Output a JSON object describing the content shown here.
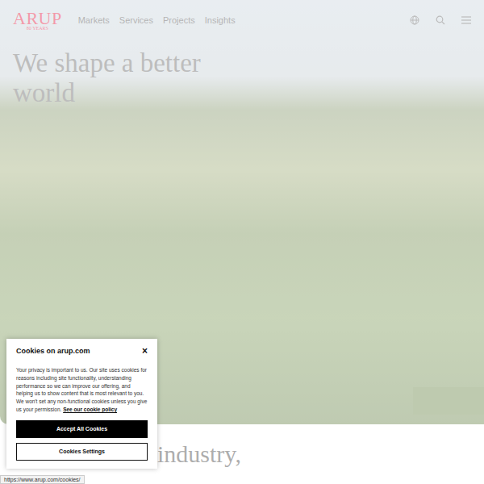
{
  "header": {
    "logo": "ARUP",
    "logo_sub": "80 YEARS",
    "nav": [
      "Markets",
      "Services",
      "Projects",
      "Insights"
    ]
  },
  "hero": {
    "title": "We shape a better world"
  },
  "intro": {
    "text": ", industry,"
  },
  "cookie_dialog": {
    "title": "Cookies on arup.com",
    "close": "×",
    "body": "Your privacy is important to us. Our site uses cookies for reasons including site functionality, understanding performance so we can improve our offering, and helping us to show content that is most relevant to you. We won't set any non-functional cookies unless you give us your permission.",
    "link": "See our cookie policy",
    "buttons": [
      {
        "label": "Accept All Cookies",
        "kind": "primary"
      },
      {
        "label": "Cookies Settings",
        "kind": "secondary"
      }
    ]
  },
  "status_bar": {
    "url": "https://www.arup.com/cookies/"
  }
}
